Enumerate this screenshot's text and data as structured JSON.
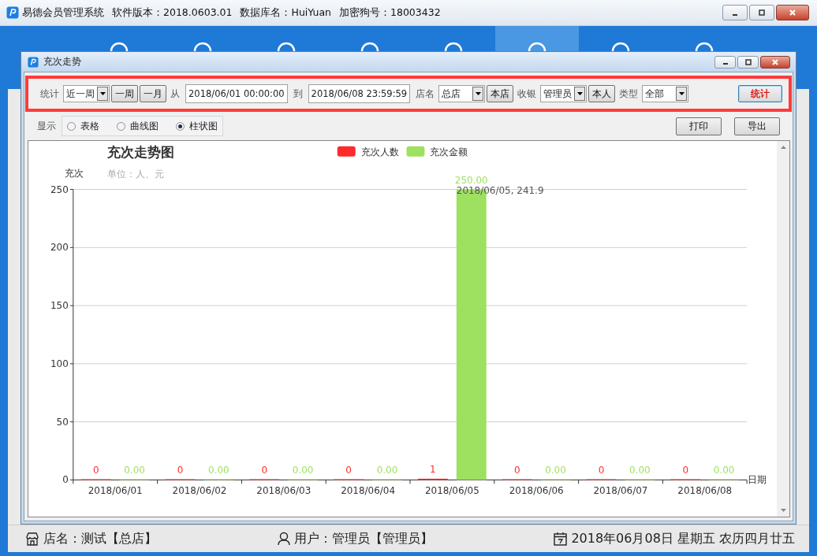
{
  "app_window": {
    "title": "易德会员管理系统",
    "version": "软件版本：2018.0603.01",
    "database": "数据库名：HuiYuan",
    "dongle": "加密狗号：18003432"
  },
  "nav_items": [
    {
      "selected": false
    },
    {
      "selected": false
    },
    {
      "selected": false
    },
    {
      "selected": false
    },
    {
      "selected": false
    },
    {
      "selected": true
    },
    {
      "selected": false
    },
    {
      "selected": false
    }
  ],
  "dialog": {
    "title": "充次走势"
  },
  "filters": [
    {
      "kind": "label",
      "text": "统计"
    },
    {
      "kind": "combo",
      "value": "近一周"
    },
    {
      "kind": "button",
      "text": "一周"
    },
    {
      "kind": "button",
      "text": "一月"
    },
    {
      "kind": "label",
      "text": "从"
    },
    {
      "kind": "input",
      "value": "2018/06/01 00:00:00"
    },
    {
      "kind": "label",
      "text": "到"
    },
    {
      "kind": "input",
      "value": "2018/06/08 23:59:59"
    },
    {
      "kind": "label",
      "text": "店名"
    },
    {
      "kind": "combo",
      "value": "总店"
    },
    {
      "kind": "button",
      "text": "本店"
    },
    {
      "kind": "label",
      "text": "收银"
    },
    {
      "kind": "combo",
      "value": "管理员"
    },
    {
      "kind": "button",
      "text": "本人"
    },
    {
      "kind": "label",
      "text": "类型"
    },
    {
      "kind": "combo",
      "value": "全部"
    },
    {
      "kind": "primary",
      "text": "统计"
    }
  ],
  "display": {
    "label": "显示",
    "options": [
      {
        "label": "表格",
        "selected": false
      },
      {
        "label": "曲线图",
        "selected": false
      },
      {
        "label": "柱状图",
        "selected": true
      }
    ]
  },
  "actions": [
    "打印",
    "导出"
  ],
  "chart": {
    "title": "充次走势图",
    "unit": "单位：人、元",
    "chart_data": {
      "type": "bar",
      "xlabel": "日期",
      "ylabel": "充次",
      "categories": [
        "2018/06/01",
        "2018/06/02",
        "2018/06/03",
        "2018/06/04",
        "2018/06/05",
        "2018/06/06",
        "2018/06/07",
        "2018/06/08"
      ],
      "series": [
        {
          "name": "充次人数",
          "color": "#ff2a2a",
          "values": [
            0,
            0,
            0,
            0,
            1,
            0,
            0,
            0
          ],
          "value_labels": [
            "0",
            "0",
            "0",
            "0",
            "1",
            "0",
            "0",
            "0"
          ]
        },
        {
          "name": "充次金额",
          "color": "#9ee060",
          "values": [
            0,
            0,
            0,
            0,
            250,
            0,
            0,
            0
          ],
          "value_labels": [
            "0.00",
            "0.00",
            "0.00",
            "0.00",
            "250.00",
            "0.00",
            "0.00",
            "0.00"
          ]
        }
      ],
      "ylim": [
        0,
        250
      ],
      "yticks": [
        0,
        50,
        100,
        150,
        200,
        250
      ],
      "data_labels": true,
      "grid": true,
      "legend": "top",
      "annotations": [
        "2018/06/05, 241.9"
      ]
    }
  },
  "status_bar": {
    "shop": "店名：测试【总店】",
    "user": "用户：管理员【管理员】",
    "date": "2018年06月08日 星期五 农历四月廿五"
  }
}
